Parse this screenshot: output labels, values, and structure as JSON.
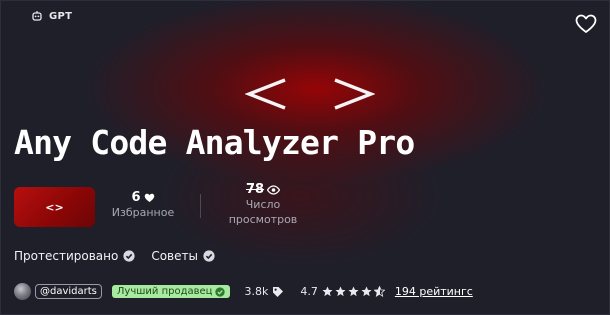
{
  "header": {
    "badge_label": "GPT",
    "badge_icon": "robot-icon",
    "favorite_icon": "heart-outline-icon"
  },
  "hero": {
    "symbol": "<  >",
    "title": "Any Code Analyzer Pro",
    "thumbnail_symbol": "<>"
  },
  "stats": {
    "favorites_count": "6",
    "favorites_label": "Избранное",
    "views_count": "78",
    "views_label_line1": "Число",
    "views_label_line2": "просмотров"
  },
  "tags": {
    "tested": "Протестировано",
    "tips": "Советы"
  },
  "footer": {
    "author": "@davidarts",
    "bestseller": "Лучший продавец",
    "sales": "3.8k",
    "rating_value": "4.7",
    "rating_fraction": 0.94,
    "ratings_link": "194 рейтингс"
  },
  "colors": {
    "accent_red": "#b80f0f",
    "background": "#1f1f2a",
    "bestseller_bg": "#a8e9a0",
    "bestseller_text": "#1b4d1b"
  }
}
